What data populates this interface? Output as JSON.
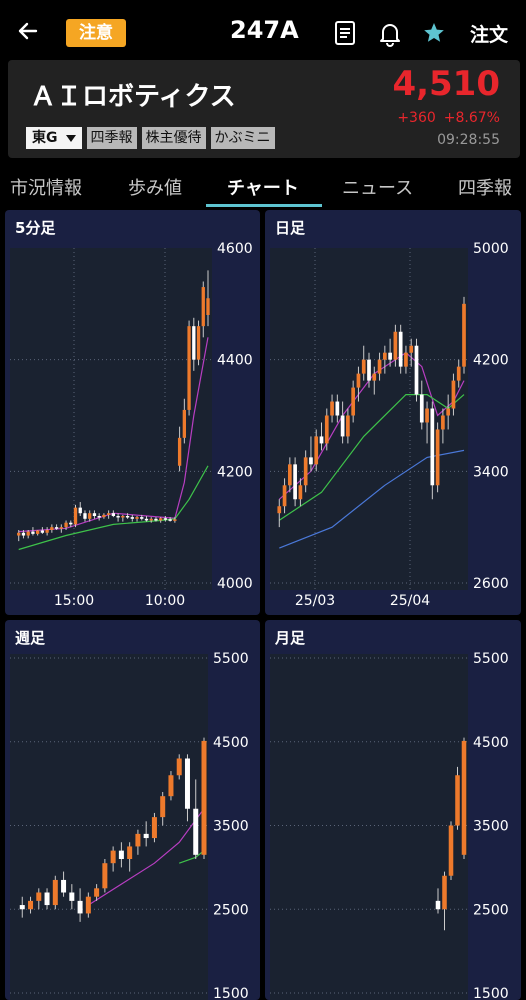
{
  "header": {
    "caution_label": "注意",
    "stock_code": "247A",
    "order_label": "注文",
    "icons": [
      "back-arrow-icon",
      "document-icon",
      "bell-icon",
      "star-icon"
    ]
  },
  "stock": {
    "name": "ＡＩロボティクス",
    "price": "4,510",
    "change": "+360",
    "change_percent": "+8.67%",
    "time": "09:28:55",
    "market": "東G",
    "tags": [
      "四季報",
      "株主優待",
      "かぶミニ"
    ]
  },
  "tabs": [
    {
      "label": "市況情報",
      "active": false
    },
    {
      "label": "歩み値",
      "active": false
    },
    {
      "label": "チャート",
      "active": true
    },
    {
      "label": "ニュース",
      "active": false
    },
    {
      "label": "四季報",
      "active": false
    }
  ],
  "colors": {
    "accent": "#5ec4d0",
    "up": "#e8262c",
    "caution": "#f5a623",
    "panel_bg": "#1a2042",
    "plot_bg": "#1a2230",
    "candle_up": "#ee7a2c",
    "candle_down": "#ffffff",
    "ma_short": "#b83ec2",
    "ma_mid": "#3ec24a",
    "ma_long": "#4a78d8"
  },
  "chart_data": [
    {
      "title": "5分足",
      "type": "candlestick",
      "ylim": [
        4000,
        4600
      ],
      "y_ticks": [
        "4600",
        "4400",
        "4200",
        "4000"
      ],
      "x_ticks": [
        "15:00",
        "10:00"
      ],
      "candles": [
        [
          4085,
          4095,
          4075,
          4090
        ],
        [
          4090,
          4095,
          4080,
          4085
        ],
        [
          4085,
          4095,
          4080,
          4092
        ],
        [
          4092,
          4100,
          4085,
          4088
        ],
        [
          4088,
          4095,
          4085,
          4094
        ],
        [
          4094,
          4100,
          4088,
          4090
        ],
        [
          4090,
          4100,
          4085,
          4095
        ],
        [
          4095,
          4105,
          4090,
          4100
        ],
        [
          4100,
          4105,
          4095,
          4098
        ],
        [
          4098,
          4105,
          4090,
          4100
        ],
        [
          4100,
          4112,
          4095,
          4108
        ],
        [
          4108,
          4112,
          4100,
          4105
        ],
        [
          4105,
          4140,
          4100,
          4135
        ],
        [
          4135,
          4145,
          4120,
          4125
        ],
        [
          4125,
          4130,
          4110,
          4115
        ],
        [
          4115,
          4130,
          4110,
          4125
        ],
        [
          4125,
          4130,
          4115,
          4120
        ],
        [
          4120,
          4125,
          4112,
          4118
        ],
        [
          4118,
          4125,
          4115,
          4122
        ],
        [
          4122,
          4130,
          4115,
          4125
        ],
        [
          4125,
          4130,
          4118,
          4120
        ],
        [
          4120,
          4125,
          4110,
          4118
        ],
        [
          4118,
          4122,
          4110,
          4120
        ],
        [
          4120,
          4125,
          4115,
          4118
        ],
        [
          4118,
          4122,
          4110,
          4115
        ],
        [
          4115,
          4120,
          4110,
          4118
        ],
        [
          4118,
          4122,
          4112,
          4115
        ],
        [
          4115,
          4120,
          4110,
          4112
        ],
        [
          4112,
          4118,
          4108,
          4115
        ],
        [
          4115,
          4118,
          4110,
          4112
        ],
        [
          4112,
          4118,
          4108,
          4116
        ],
        [
          4116,
          4120,
          4110,
          4114
        ],
        [
          4114,
          4118,
          4110,
          4112
        ],
        [
          4112,
          4118,
          4108,
          4114
        ],
        [
          4210,
          4280,
          4200,
          4260
        ],
        [
          4260,
          4330,
          4250,
          4310
        ],
        [
          4310,
          4470,
          4300,
          4460
        ],
        [
          4460,
          4475,
          4380,
          4400
        ],
        [
          4400,
          4470,
          4390,
          4460
        ],
        [
          4460,
          4540,
          4440,
          4530
        ],
        [
          4480,
          4560,
          4460,
          4510
        ]
      ],
      "ma": [
        {
          "color": "ma_short",
          "values": [
            [
              0,
              4092
            ],
            [
              10,
              4098
            ],
            [
              20,
              4125
            ],
            [
              30,
              4118
            ],
            [
              33,
              4116
            ],
            [
              35,
              4180
            ],
            [
              37,
              4300
            ],
            [
              40,
              4440
            ]
          ]
        },
        {
          "color": "ma_mid",
          "values": [
            [
              0,
              4060
            ],
            [
              10,
              4085
            ],
            [
              20,
              4105
            ],
            [
              30,
              4112
            ],
            [
              33,
              4115
            ],
            [
              36,
              4150
            ],
            [
              40,
              4210
            ]
          ]
        }
      ]
    },
    {
      "title": "日足",
      "type": "candlestick",
      "ylim": [
        2600,
        5000
      ],
      "y_ticks": [
        "5000",
        "4200",
        "3400",
        "2600"
      ],
      "x_ticks": [
        "25/03",
        "25/04"
      ],
      "candles": [
        [
          3100,
          3200,
          3000,
          3150
        ],
        [
          3150,
          3350,
          3100,
          3300
        ],
        [
          3300,
          3500,
          3250,
          3450
        ],
        [
          3450,
          3500,
          3150,
          3200
        ],
        [
          3200,
          3350,
          3150,
          3300
        ],
        [
          3300,
          3550,
          3250,
          3500
        ],
        [
          3500,
          3650,
          3400,
          3450
        ],
        [
          3450,
          3700,
          3400,
          3650
        ],
        [
          3650,
          3750,
          3550,
          3600
        ],
        [
          3600,
          3850,
          3550,
          3800
        ],
        [
          3800,
          3950,
          3750,
          3900
        ],
        [
          3900,
          3950,
          3750,
          3800
        ],
        [
          3800,
          3900,
          3600,
          3650
        ],
        [
          3650,
          3850,
          3600,
          3800
        ],
        [
          3800,
          4050,
          3750,
          4000
        ],
        [
          4000,
          4150,
          3900,
          4100
        ],
        [
          4100,
          4300,
          4050,
          4200
        ],
        [
          4200,
          4250,
          4000,
          4050
        ],
        [
          4050,
          4150,
          3950,
          4100
        ],
        [
          4100,
          4250,
          4050,
          4200
        ],
        [
          4200,
          4300,
          4100,
          4250
        ],
        [
          4250,
          4350,
          4150,
          4200
        ],
        [
          4200,
          4450,
          4150,
          4400
        ],
        [
          4400,
          4450,
          4100,
          4150
        ],
        [
          4150,
          4300,
          4100,
          4250
        ],
        [
          4250,
          4350,
          4150,
          4300
        ],
        [
          4300,
          4350,
          3900,
          3950
        ],
        [
          3950,
          4050,
          3700,
          3750
        ],
        [
          3750,
          3900,
          3600,
          3850
        ],
        [
          3850,
          3900,
          3200,
          3300
        ],
        [
          3300,
          3750,
          3250,
          3700
        ],
        [
          3700,
          3850,
          3600,
          3800
        ],
        [
          3800,
          3950,
          3700,
          3850
        ],
        [
          3850,
          4100,
          3800,
          4050
        ],
        [
          4050,
          4200,
          4000,
          4150
        ],
        [
          4150,
          4650,
          4100,
          4600
        ]
      ],
      "ma": [
        {
          "color": "ma_short",
          "values": [
            [
              0,
              3200
            ],
            [
              6,
              3400
            ],
            [
              12,
              3800
            ],
            [
              18,
              4100
            ],
            [
              24,
              4250
            ],
            [
              27,
              4150
            ],
            [
              30,
              3800
            ],
            [
              33,
              3900
            ],
            [
              35,
              4050
            ]
          ]
        },
        {
          "color": "ma_mid",
          "values": [
            [
              0,
              3050
            ],
            [
              8,
              3250
            ],
            [
              16,
              3650
            ],
            [
              24,
              3950
            ],
            [
              28,
              3950
            ],
            [
              32,
              3850
            ],
            [
              35,
              3950
            ]
          ]
        },
        {
          "color": "ma_long",
          "values": [
            [
              0,
              2850
            ],
            [
              10,
              3000
            ],
            [
              20,
              3300
            ],
            [
              28,
              3500
            ],
            [
              35,
              3550
            ]
          ]
        }
      ]
    },
    {
      "title": "週足",
      "type": "candlestick",
      "ylim": [
        1500,
        5500
      ],
      "y_ticks": [
        "5500",
        "4500",
        "3500",
        "2500",
        "1500"
      ],
      "x_ticks": [],
      "candles": [
        [
          2550,
          2650,
          2400,
          2500
        ],
        [
          2500,
          2650,
          2450,
          2600
        ],
        [
          2600,
          2750,
          2500,
          2700
        ],
        [
          2700,
          2750,
          2500,
          2550
        ],
        [
          2550,
          2900,
          2500,
          2850
        ],
        [
          2850,
          2950,
          2650,
          2700
        ],
        [
          2700,
          2800,
          2500,
          2600
        ],
        [
          2600,
          2750,
          2350,
          2450
        ],
        [
          2450,
          2700,
          2400,
          2650
        ],
        [
          2650,
          2800,
          2600,
          2750
        ],
        [
          2750,
          3100,
          2700,
          3050
        ],
        [
          3050,
          3250,
          2950,
          3200
        ],
        [
          3200,
          3300,
          3000,
          3100
        ],
        [
          3100,
          3300,
          2950,
          3250
        ],
        [
          3250,
          3450,
          3150,
          3400
        ],
        [
          3400,
          3550,
          3250,
          3350
        ],
        [
          3350,
          3650,
          3300,
          3600
        ],
        [
          3600,
          3900,
          3500,
          3850
        ],
        [
          3850,
          4150,
          3800,
          4100
        ],
        [
          4100,
          4350,
          4050,
          4300
        ],
        [
          4300,
          4350,
          3550,
          3700
        ],
        [
          3700,
          4050,
          3100,
          3150
        ],
        [
          3150,
          4550,
          3100,
          4510
        ]
      ],
      "ma": [
        {
          "color": "ma_short",
          "values": [
            [
              8,
              2550
            ],
            [
              12,
              2800
            ],
            [
              16,
              3050
            ],
            [
              19,
              3300
            ],
            [
              22,
              3700
            ]
          ]
        },
        {
          "color": "ma_mid",
          "values": [
            [
              19,
              3050
            ],
            [
              21,
              3120
            ],
            [
              22,
              3200
            ]
          ]
        }
      ]
    },
    {
      "title": "月足",
      "type": "candlestick",
      "ylim": [
        1500,
        5500
      ],
      "y_ticks": [
        "5500",
        "4500",
        "3500",
        "2500",
        "1500"
      ],
      "x_ticks": [],
      "candles": [
        [
          2600,
          2750,
          2450,
          2500
        ],
        [
          2500,
          2950,
          2250,
          2900
        ],
        [
          2900,
          3550,
          2850,
          3500
        ],
        [
          3500,
          4200,
          3450,
          4100
        ],
        [
          3150,
          4550,
          3100,
          4510
        ]
      ],
      "ma": []
    }
  ]
}
